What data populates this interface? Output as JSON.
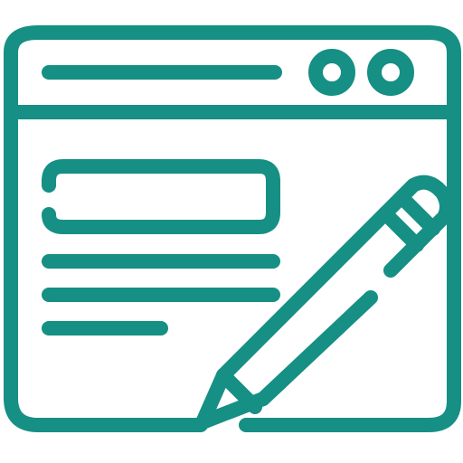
{
  "icon": {
    "name": "web-form-edit-icon",
    "stroke_color": "#168F84",
    "background_color": "#FFFFFF"
  }
}
